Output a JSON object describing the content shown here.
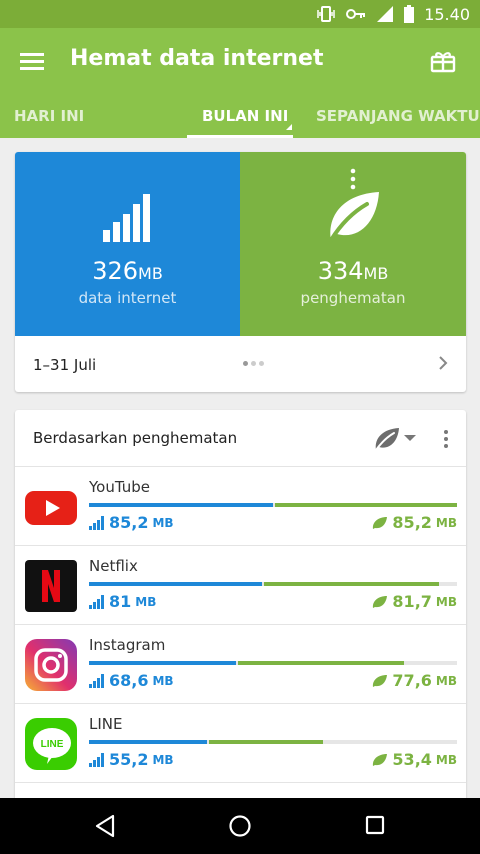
{
  "status": {
    "time": "15.40"
  },
  "app_bar": {
    "title": "Hemat data internet"
  },
  "tabs": [
    {
      "label": "HARI INI"
    },
    {
      "label": "BULAN INI"
    },
    {
      "label": "SEPANJANG WAKTU"
    }
  ],
  "summary": {
    "data": {
      "value": "326",
      "unit": "MB",
      "label": "data internet"
    },
    "saving": {
      "value": "334",
      "unit": "MB",
      "label": "penghematan"
    },
    "date_range": "1–31 Juli"
  },
  "list": {
    "title": "Berdasarkan penghematan",
    "apps": [
      {
        "name": "YouTube",
        "usage": "85,2",
        "usage_unit": "MB",
        "saving": "85,2",
        "saving_unit": "MB",
        "usage_fraction": 0.5,
        "saving_fraction": 0.5
      },
      {
        "name": "Netflix",
        "usage": "81",
        "usage_unit": "MB",
        "saving": "81,7",
        "saving_unit": "MB",
        "usage_fraction": 0.47,
        "saving_fraction": 0.48
      },
      {
        "name": "Instagram",
        "usage": "68,6",
        "usage_unit": "MB",
        "saving": "77,6",
        "saving_unit": "MB",
        "usage_fraction": 0.4,
        "saving_fraction": 0.45
      },
      {
        "name": "LINE",
        "usage": "55,2",
        "usage_unit": "MB",
        "saving": "53,4",
        "saving_unit": "MB",
        "usage_fraction": 0.32,
        "saving_fraction": 0.31
      }
    ]
  },
  "colors": {
    "green": "#8bc34a",
    "blue": "#1e88d8",
    "leaf_green": "#7cb342"
  }
}
